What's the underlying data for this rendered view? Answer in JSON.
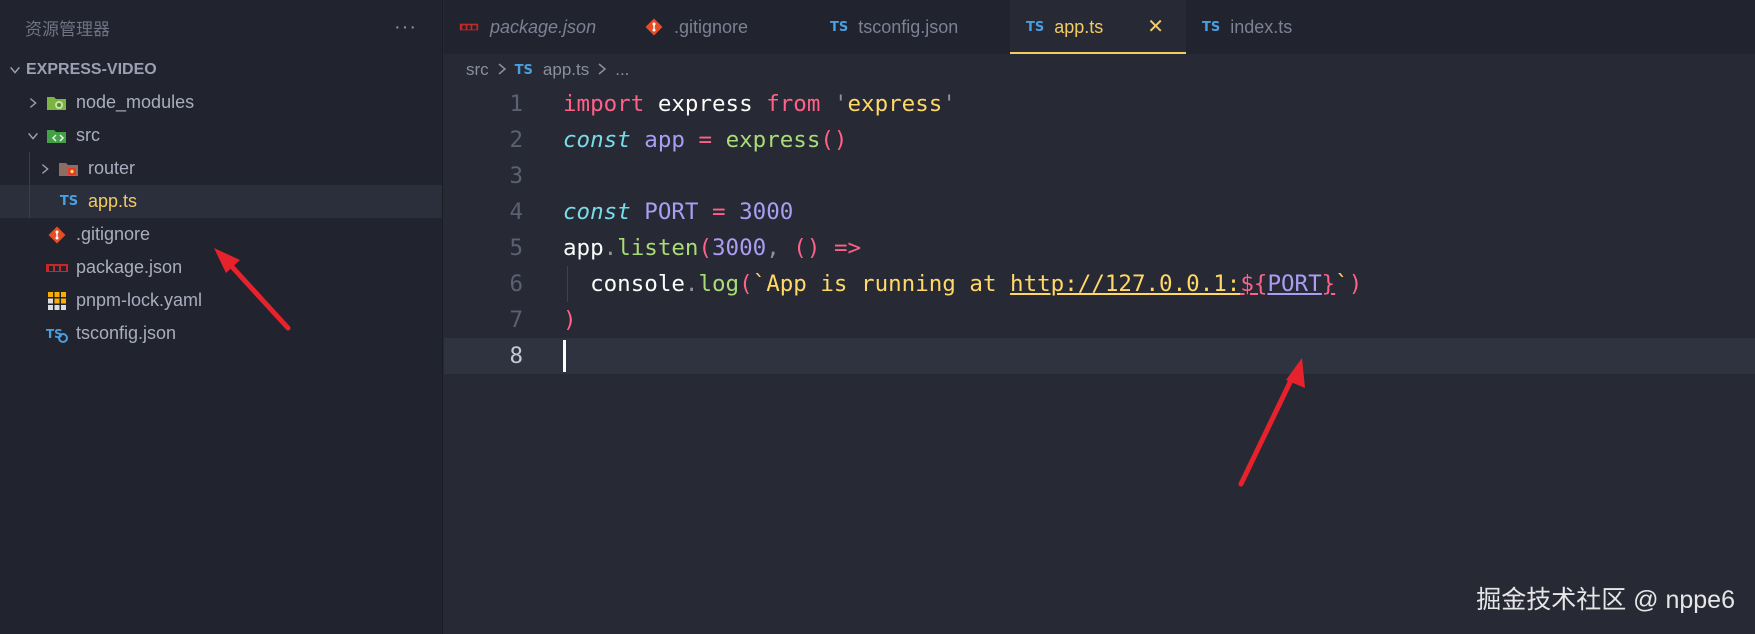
{
  "sidebar": {
    "title": "资源管理器",
    "more": "···",
    "project": "EXPRESS-VIDEO",
    "items": [
      {
        "label": "node_modules",
        "icon": "folder-node-icon",
        "expandable": true
      },
      {
        "label": "src",
        "icon": "folder-src-icon",
        "expanded": true
      },
      {
        "label": "router",
        "icon": "folder-router-icon",
        "expandable": true
      },
      {
        "label": "app.ts",
        "icon": "ts-file-icon",
        "active": true
      },
      {
        "label": ".gitignore",
        "icon": "git-icon"
      },
      {
        "label": "package.json",
        "icon": "npm-icon"
      },
      {
        "label": "pnpm-lock.yaml",
        "icon": "pnpm-icon"
      },
      {
        "label": "tsconfig.json",
        "icon": "tsconfig-icon"
      }
    ]
  },
  "tabs": [
    {
      "label": "package.json",
      "icon": "npm-icon",
      "italic": true
    },
    {
      "label": ".gitignore",
      "icon": "git-icon"
    },
    {
      "label": "tsconfig.json",
      "icon": "TS"
    },
    {
      "label": "app.ts",
      "icon": "TS",
      "active": true,
      "close": "✕"
    },
    {
      "label": "index.ts",
      "icon": "TS"
    }
  ],
  "ts_badge": "TS",
  "breadcrumb": {
    "folder": "src",
    "file": "app.ts",
    "rest": "..."
  },
  "editor": {
    "line_numbers": [
      "1",
      "2",
      "3",
      "4",
      "5",
      "6",
      "7",
      "8"
    ],
    "current_line": 8,
    "line1": {
      "kw": "import",
      "id": "express",
      "from": "from",
      "q1": "'",
      "str": "express",
      "q2": "'"
    },
    "line2": {
      "kw": "const",
      "id": "app",
      "eq": "=",
      "fn": "express",
      "parens": "()"
    },
    "line4": {
      "kw": "const",
      "id": "PORT",
      "eq": "=",
      "num": "3000"
    },
    "line5": {
      "obj": "app",
      "dot": ".",
      "fn": "listen",
      "open": "(",
      "num": "3000",
      "comma": ",",
      "arrowparens": "()",
      "arrow": "=>"
    },
    "line6": {
      "obj": "console",
      "dot": ".",
      "fn": "log",
      "open": "(",
      "tick": "`",
      "str": "App is running at ",
      "url": "http://127.0.0.1:",
      "interp_open": "${",
      "interp_var": "PORT",
      "interp_close": "}",
      "tick2": "`",
      "close": ")"
    },
    "line7": {
      "close": ")"
    }
  },
  "watermark": "掘金技术社区 @ nppe6",
  "colors": {
    "accent": "#f2cc60",
    "arrow": "#e8222c",
    "background": "#272935",
    "sidebar": "#21232e"
  }
}
